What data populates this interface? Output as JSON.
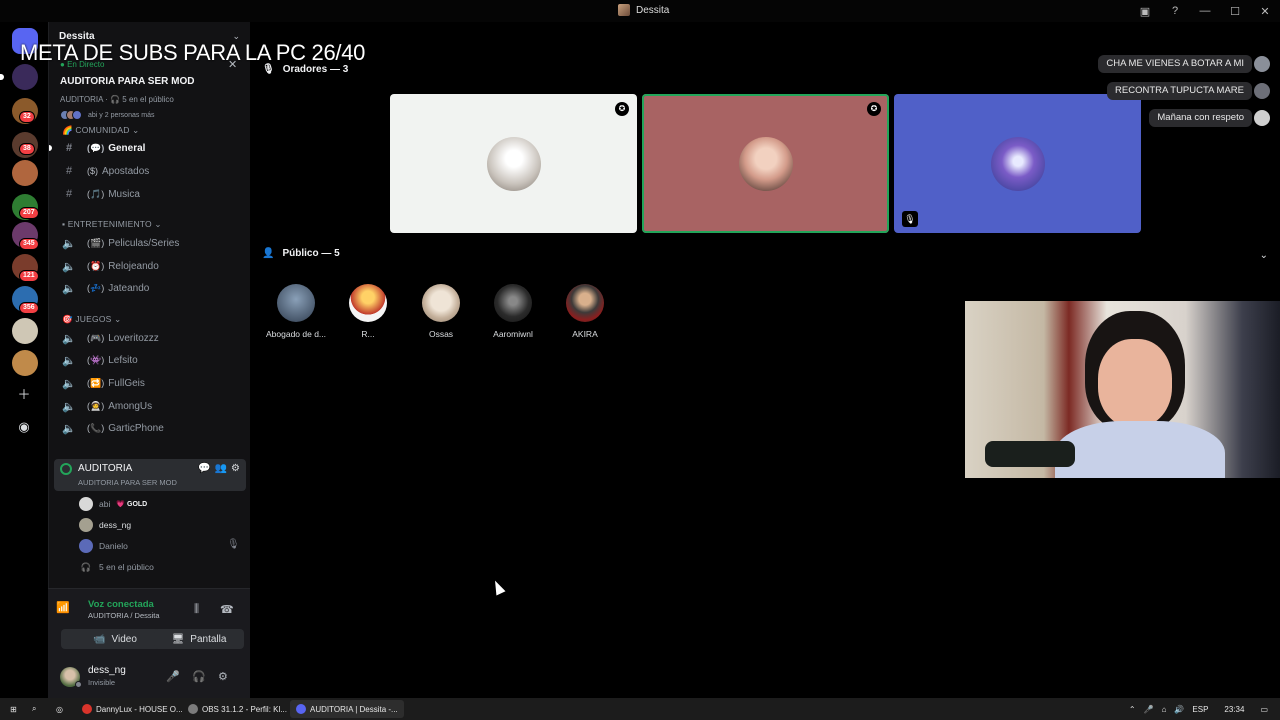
{
  "window": {
    "title": "Dessita"
  },
  "overlay": {
    "goal_text": "META DE SUBS PARA LA PC 26/40",
    "chat": [
      {
        "text": "CHA ME VIENES A BOTAR A MI",
        "avatar_color": "#8a8f99"
      },
      {
        "text": "RECONTRA TUPUCTA MARE",
        "avatar_color": "#6d6f78"
      },
      {
        "text": "Mañana con respeto",
        "avatar_color": "#cfcfcf"
      }
    ]
  },
  "rail": {
    "badges": [
      "32",
      "38",
      "207",
      "345",
      "121",
      "356"
    ],
    "servers": [
      "#5865f2",
      "#3a2a5a",
      "#8b5a2b",
      "#5a3b2e",
      "#b0663e",
      "#2e7d32",
      "#6c3a6b",
      "#7a3c2c",
      "#2c6db0",
      "#cfc7b5",
      "#c08a4a"
    ]
  },
  "sidebar": {
    "server_name": "Dessita",
    "live_label": "En Directo",
    "stage": {
      "title": "AUDITORIA PARA SER MOD",
      "subtitle": "AUDITORIA · 🎧 5 en el público",
      "people": "abi y 2 personas más"
    },
    "categories": {
      "comunidad": "COMUNIDAD",
      "entretenimiento": "ENTRETENIMIENTO",
      "juegos": "JUEGOS"
    },
    "text_channels": [
      {
        "emoji": "(💬)",
        "name": "General"
      },
      {
        "emoji": "($)",
        "name": "Apostados"
      },
      {
        "emoji": "(🎵)",
        "name": "Musica"
      }
    ],
    "ent_channels": [
      {
        "emoji": "(🎬)",
        "name": "Peliculas/Series"
      },
      {
        "emoji": "(⏰)",
        "name": "Relojeando"
      },
      {
        "emoji": "(💤)",
        "name": "Jateando"
      }
    ],
    "game_channels": [
      {
        "emoji": "(🎮)",
        "name": "Loveritozzz"
      },
      {
        "emoji": "(👾)",
        "name": "Lefsito"
      },
      {
        "emoji": "(🔁)",
        "name": "FullGeis"
      },
      {
        "emoji": "(🧑‍🚀)",
        "name": "AmongUs"
      },
      {
        "emoji": "(📞)",
        "name": "GarticPhone"
      }
    ],
    "voice_channel": {
      "name": "AUDITORIA",
      "subtitle": "AUDITORIA PARA SER MOD"
    },
    "voice_users": [
      {
        "name": "abi",
        "tag": "💗 GOLD",
        "color": "#d8d8d8"
      },
      {
        "name": "dess_ng",
        "tag": "",
        "color": "#a4a090"
      },
      {
        "name": "Danielo",
        "tag": "",
        "color": "#5b6ab8"
      }
    ],
    "audience_count": "5 en el público"
  },
  "panel": {
    "voice_title": "Voz conectada",
    "voice_sub": "AUDITORIA / Dessita",
    "video_label": "Video",
    "screen_label": "Pantalla",
    "user_name": "dess_ng",
    "user_status": "Invisible"
  },
  "stage_main": {
    "speakers_header": "Oradores — 3",
    "speakers": [
      {
        "bg": "#f1f3f1",
        "avatar": "#c9c3bc",
        "moderator": true,
        "muted": false
      },
      {
        "bg": "#a86363",
        "avatar": "#d39b8a",
        "moderator": true,
        "muted": false,
        "speaking": true
      },
      {
        "bg": "#5060c8",
        "avatar": "#3c4ea0",
        "moderator": false,
        "muted": true
      }
    ],
    "audience_header": "Público — 5",
    "audience": [
      {
        "name": "Abogado de d...",
        "color": "#4a5a6e"
      },
      {
        "name": "R...",
        "color": "#c0392b"
      },
      {
        "name": "Ossas",
        "color": "#c4b09b"
      },
      {
        "name": "Aaromiwnl",
        "color": "#2b2b2b"
      },
      {
        "name": "AKIRA",
        "color": "#3d3a39"
      }
    ]
  },
  "taskbar": {
    "items": [
      {
        "label": "DannyLux - HOUSE O...",
        "color": "#d9342b"
      },
      {
        "label": "OBS 31.1.2 - Perfil: Kl...",
        "color": "#7c7c7c"
      },
      {
        "label": "AUDITORIA | Dessita -...",
        "color": "#5865f2"
      }
    ],
    "lang": "ESP",
    "time": "23:34"
  }
}
